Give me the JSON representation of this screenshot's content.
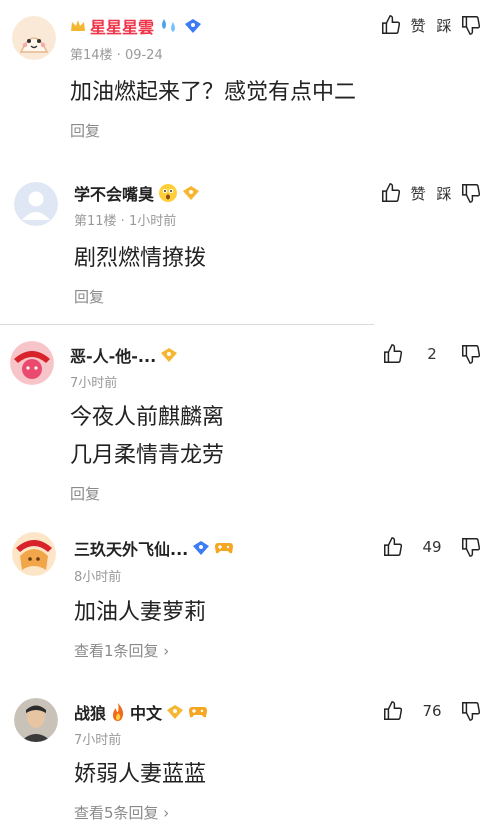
{
  "comments": [
    {
      "username": "星星星雲",
      "meta": "第14楼 · 09-24",
      "lines": [
        "加油燃起来了？感觉有点中二"
      ],
      "reply_label": "回复",
      "like_label": "赞",
      "dislike_label": "踩"
    },
    {
      "username": "学不会嘴臭",
      "meta": "第11楼 · 1小时前",
      "lines": [
        "剧烈燃情撩拨"
      ],
      "reply_label": "回复",
      "like_label": "赞",
      "dislike_label": "踩"
    },
    {
      "username": "恶-人-他-...",
      "meta": "7小时前",
      "lines": [
        "今夜人前麒麟离",
        "几月柔情青龙劳"
      ],
      "reply_label": "回复",
      "like_count": "2"
    },
    {
      "username": "三玖天外飞仙...",
      "meta": "8小时前",
      "lines": [
        "加油人妻萝莉"
      ],
      "reply_label": "查看1条回复 ›",
      "like_count": "49"
    },
    {
      "username": "战狼",
      "username_suffix": "中文",
      "meta": "7小时前",
      "lines": [
        "娇弱人妻蓝蓝"
      ],
      "reply_label": "查看5条回复 ›",
      "like_count": "76"
    }
  ],
  "colors": {
    "vip_name": "#f0344a",
    "meta": "#9a9a9a",
    "badge_gold": "#f5b731",
    "badge_blue": "#3d7bf5"
  },
  "icons": [
    "crown-icon",
    "droplets-icon",
    "diamond-badge-icon",
    "level-badge-icon",
    "thumbs-up-icon",
    "thumbs-down-icon",
    "gamepad-icon",
    "flame-icon"
  ]
}
